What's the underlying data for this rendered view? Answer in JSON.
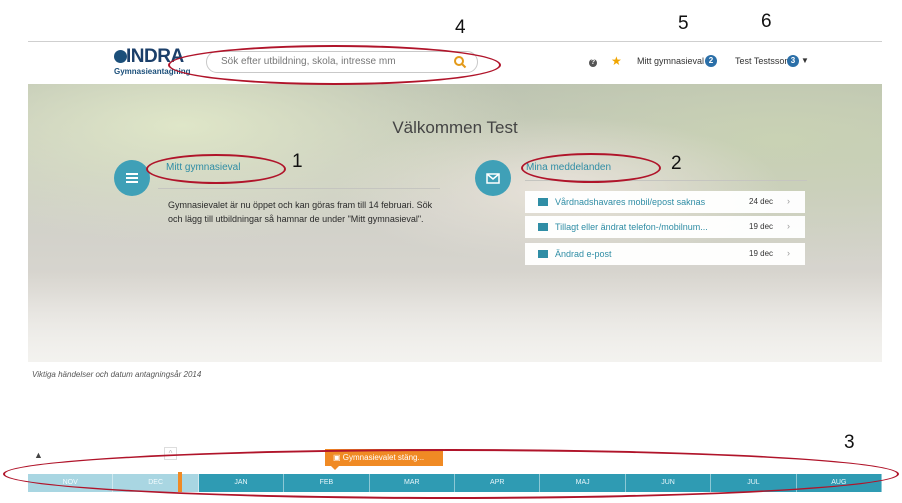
{
  "annotations": {
    "n1": "1",
    "n2": "2",
    "n3": "3",
    "n4": "4",
    "n5": "5",
    "n6": "6"
  },
  "header": {
    "logo_text": "INDRA",
    "logo_sub": "Gymnasieantagning",
    "search_placeholder": "Sök efter utbildning, skola, intresse mm",
    "help_label": "?",
    "mitt_gymnasieval_label": "Mitt gymnasieval",
    "mitt_gymnasieval_badge": "2",
    "user_name": "Test Testsson",
    "user_badge": "3"
  },
  "hero": {
    "welcome": "Välkommen Test",
    "mitt_title": "Mitt gymnasieval",
    "mitt_text": "Gymnasievalet är nu öppet och kan göras fram till 14 februari. Sök och lägg till utbildningar så hamnar de under \"Mitt gymnasieval\".",
    "meddelanden_title": "Mina meddelanden",
    "messages": [
      {
        "text": "Vårdnadshavares mobil/epost saknas",
        "date": "24 dec"
      },
      {
        "text": "Tillagt eller ändrat telefon-/mobilnum...",
        "date": "19 dec"
      },
      {
        "text": "Ändrad e-post",
        "date": "19 dec"
      }
    ]
  },
  "timeline": {
    "caption": "Viktiga händelser och datum antagningsår 2014",
    "event_label": "Gymnasievalet stäng...",
    "months": [
      "NOV",
      "DEC",
      "JAN",
      "FEB",
      "MAR",
      "APR",
      "MAJ",
      "JUN",
      "JUL",
      "AUG"
    ]
  },
  "colors": {
    "accent": "#2f8da5",
    "timeline": "#2f9bb3",
    "event": "#f08a24",
    "annotation": "#b0142a"
  }
}
